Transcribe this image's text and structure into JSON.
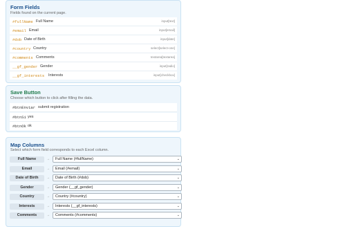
{
  "form_fields": {
    "title": "Form Fields",
    "subtitle": "Fields found on the current page.",
    "items": [
      {
        "id": "#fullName",
        "label": "Full Name",
        "type": "input[text]"
      },
      {
        "id": "#email",
        "label": "Email",
        "type": "input[email]"
      },
      {
        "id": "#dob",
        "label": "Date of Birth",
        "type": "input[date]"
      },
      {
        "id": "#country",
        "label": "Country",
        "type": "select[select-one]"
      },
      {
        "id": "#comments",
        "label": "Comments",
        "type": "textarea[textarea]"
      },
      {
        "id": "__gf_gender",
        "label": "Gender",
        "type": "input[radio]"
      },
      {
        "id": "__gf_interests",
        "label": "Interests",
        "type": "input[checkbox]"
      }
    ]
  },
  "save_button": {
    "title": "Save Button",
    "subtitle": "Choose which button to click after filling the data.",
    "items": [
      {
        "id": "#btnEnviar",
        "label": "submit registration"
      },
      {
        "id": "#btnSi",
        "label": "yes"
      },
      {
        "id": "#btnOk",
        "label": "ok"
      }
    ]
  },
  "map_columns": {
    "title": "Map Columns",
    "subtitle": "Select which form field corresponds to each Excel column.",
    "arrow": "→",
    "rows": [
      {
        "column": "Full Name",
        "selected": "Full Name (#fullName)"
      },
      {
        "column": "Email",
        "selected": "Email (#email)"
      },
      {
        "column": "Date of Birth",
        "selected": "Date of Birth (#dob)"
      },
      {
        "column": "Gender",
        "selected": "Gender (__gf_gender)"
      },
      {
        "column": "Country",
        "selected": "Country (#country)"
      },
      {
        "column": "Interests",
        "selected": "Interests (__gf_interests)"
      },
      {
        "column": "Comments",
        "selected": "Comments (#comments)"
      }
    ]
  },
  "colors": {
    "form_fields_title": "#1a4f8b",
    "save_button_title": "#1f7a4a",
    "map_columns_title": "#1a4f8b",
    "field_id": "#d08a1a",
    "panel_bg": "#eef6fc"
  },
  "icons": {
    "select_chevron": "chevron-down-icon"
  }
}
